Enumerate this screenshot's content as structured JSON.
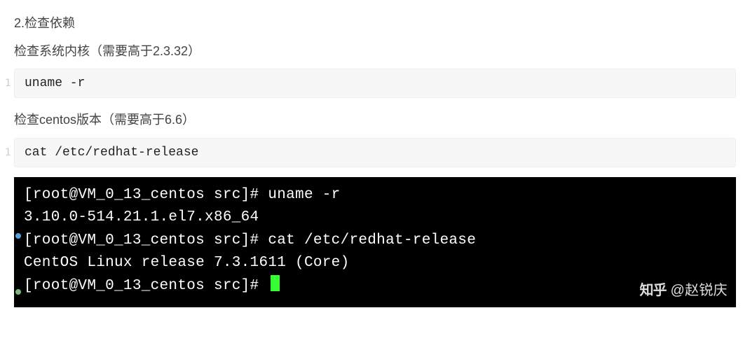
{
  "heading": "2.检查依赖",
  "para1": "检查系统内核（需要高于2.3.32）",
  "code1": {
    "lineno": "1",
    "content": "uname -r"
  },
  "para2": "检查centos版本（需要高于6.6）",
  "code2": {
    "lineno": "1",
    "content": "cat /etc/redhat-release"
  },
  "terminal": {
    "lines": [
      "[root@VM_0_13_centos src]# uname -r",
      "3.10.0-514.21.1.el7.x86_64",
      "[root@VM_0_13_centos src]# cat /etc/redhat-release",
      "CentOS Linux release 7.3.1611 (Core)",
      "[root@VM_0_13_centos src]# "
    ]
  },
  "watermark": {
    "logo": "知乎",
    "author": "@赵锐庆"
  }
}
